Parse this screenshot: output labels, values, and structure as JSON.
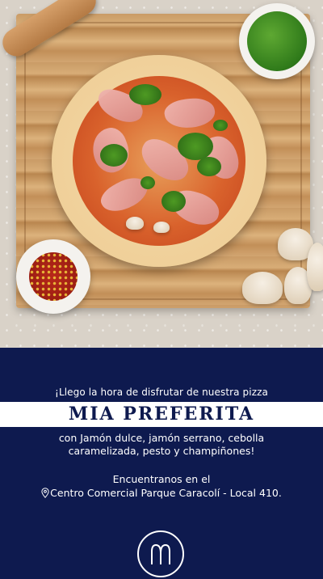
{
  "promo": {
    "tagline": "¡Llego la hora de disfrutar de nuestra pizza",
    "title": "MIA PREFERITA",
    "description": "con Jamón dulce, jamón serrano, cebolla caramelizada, pesto y champiñones!",
    "location_intro": "Encuentranos en el",
    "address": "Centro Comercial Parque Caracolí - Local 410."
  },
  "icons": {
    "location": "map-pin-icon",
    "brand": "m-logo-icon"
  },
  "colors": {
    "navy": "#0e1a4f",
    "white": "#ffffff"
  }
}
